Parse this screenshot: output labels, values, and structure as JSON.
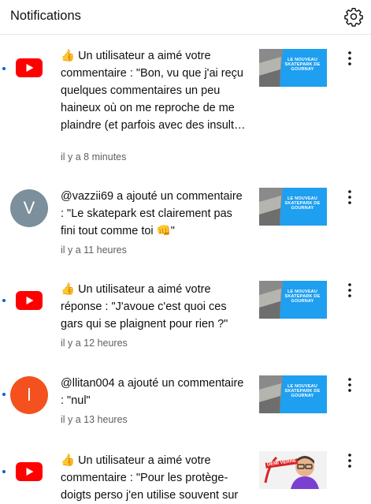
{
  "header": {
    "title": "Notifications",
    "settings_icon": "gear-icon"
  },
  "colors": {
    "accent_blue": "#065fd4",
    "youtube_red": "#ff0000",
    "thumbnail_blue": "#1e9ff0",
    "avatar_v": "#7b8f9c",
    "avatar_l": "#f4511e"
  },
  "notifications": [
    {
      "unread": true,
      "avatar_type": "youtube-logo",
      "text": "👍 Un utilisateur a aimé votre commentaire : \"Bon, vu que j'ai reçu quelques commentaires un peu haineux où on me reproche de me plaindre (et parfois avec des insultes donc j'ai signalé les commentaires), …",
      "time": "il y a 8 minutes",
      "thumbnail_text": "LE NOUVEAU SKATEPARK DE GOURNAY"
    },
    {
      "unread": false,
      "avatar_type": "letter",
      "avatar_letter": "V",
      "text": "@vazzii69 a ajouté un commentaire : \"Le skatepark est clairement pas fini tout comme toi 👊\"",
      "time": "il y a 11 heures",
      "thumbnail_text": "LE NOUVEAU SKATEPARK DE GOURNAY"
    },
    {
      "unread": true,
      "avatar_type": "youtube-logo",
      "text": "👍 Un utilisateur a aimé votre réponse : \"J'avoue c'est quoi ces gars qui se plaignent pour rien ?\"",
      "time": "il y a 12 heures",
      "thumbnail_text": "LE NOUVEAU SKATEPARK DE GOURNAY"
    },
    {
      "unread": true,
      "avatar_type": "letter",
      "avatar_letter": "l",
      "text": "@llitan004 a ajouté un commentaire : \"nul\"",
      "time": "il y a 13 heures",
      "thumbnail_text": "LE NOUVEAU SKATEPARK DE GOURNAY"
    },
    {
      "unread": true,
      "avatar_type": "youtube-logo",
      "text": "👍 Un utilisateur a aimé votre commentaire : \"Pour les protège-doigts perso j'en utilise souvent sur",
      "time": "",
      "thumbnail_text": "DEMI VERRE"
    }
  ]
}
